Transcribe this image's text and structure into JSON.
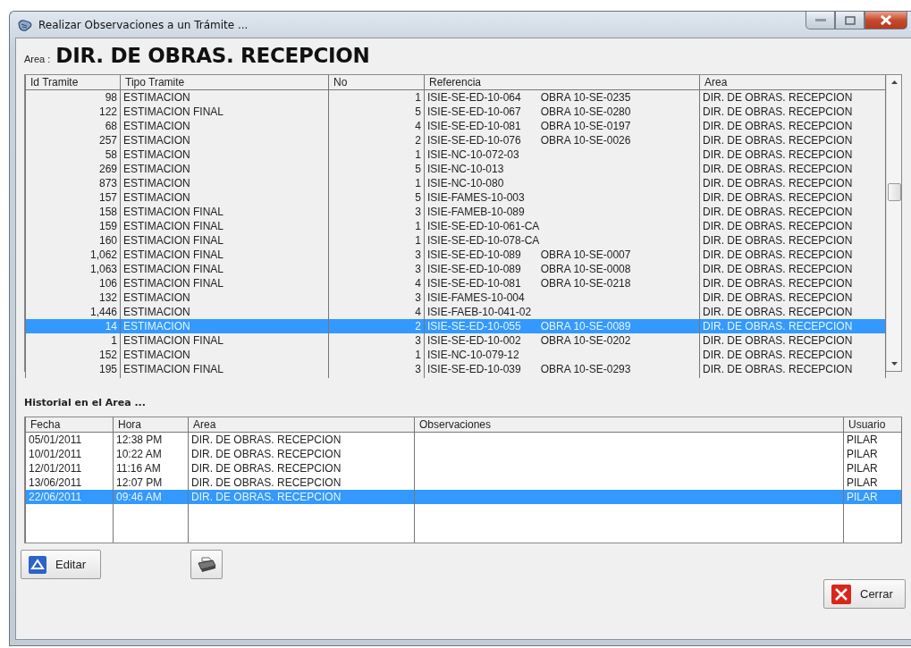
{
  "window": {
    "title": "Realizar Observaciones a un Trámite ..."
  },
  "area_header": {
    "label": "Area :",
    "value": "DIR. DE OBRAS. RECEPCION"
  },
  "tramites": {
    "columns": [
      "Id Tramite",
      "Tipo Tramite",
      "No",
      "Referencia",
      "Area"
    ],
    "rows": [
      {
        "id": "98",
        "tipo": "ESTIMACION",
        "no": "1",
        "ref": "ISIE-SE-ED-10-064",
        "obra": "OBRA 10-SE-0235",
        "area": "DIR. DE OBRAS. RECEPCION",
        "selected": false
      },
      {
        "id": "122",
        "tipo": "ESTIMACION FINAL",
        "no": "5",
        "ref": "ISIE-SE-ED-10-067",
        "obra": "OBRA 10-SE-0280",
        "area": "DIR. DE OBRAS. RECEPCION",
        "selected": false
      },
      {
        "id": "68",
        "tipo": "ESTIMACION",
        "no": "4",
        "ref": "ISIE-SE-ED-10-081",
        "obra": "OBRA 10-SE-0197",
        "area": "DIR. DE OBRAS. RECEPCION",
        "selected": false
      },
      {
        "id": "257",
        "tipo": "ESTIMACION",
        "no": "2",
        "ref": "ISIE-SE-ED-10-076",
        "obra": "OBRA 10-SE-0026",
        "area": "DIR. DE OBRAS. RECEPCION",
        "selected": false
      },
      {
        "id": "58",
        "tipo": "ESTIMACION",
        "no": "1",
        "ref": "ISIE-NC-10-072-03",
        "area": "DIR. DE OBRAS. RECEPCION",
        "selected": false
      },
      {
        "id": "269",
        "tipo": "ESTIMACION",
        "no": "5",
        "ref": "ISIE-NC-10-013",
        "area": "DIR. DE OBRAS. RECEPCION",
        "selected": false
      },
      {
        "id": "873",
        "tipo": "ESTIMACION",
        "no": "1",
        "ref": "ISIE-NC-10-080",
        "area": "DIR. DE OBRAS. RECEPCION",
        "selected": false
      },
      {
        "id": "157",
        "tipo": "ESTIMACION",
        "no": "5",
        "ref": "ISIE-FAMES-10-003",
        "area": "DIR. DE OBRAS. RECEPCION",
        "selected": false
      },
      {
        "id": "158",
        "tipo": "ESTIMACION FINAL",
        "no": "3",
        "ref": "ISIE-FAMEB-10-089",
        "area": "DIR. DE OBRAS. RECEPCION",
        "selected": false
      },
      {
        "id": "159",
        "tipo": "ESTIMACION FINAL",
        "no": "1",
        "ref": "ISIE-SE-ED-10-061-CA",
        "area": "DIR. DE OBRAS. RECEPCION",
        "selected": false
      },
      {
        "id": "160",
        "tipo": "ESTIMACION FINAL",
        "no": "1",
        "ref": "ISIE-SE-ED-10-078-CA",
        "area": "DIR. DE OBRAS. RECEPCION",
        "selected": false
      },
      {
        "id": "1,062",
        "tipo": "ESTIMACION FINAL",
        "no": "3",
        "ref": "ISIE-SE-ED-10-089",
        "obra": "OBRA 10-SE-0007",
        "area": "DIR. DE OBRAS. RECEPCION",
        "selected": false
      },
      {
        "id": "1,063",
        "tipo": "ESTIMACION FINAL",
        "no": "3",
        "ref": "ISIE-SE-ED-10-089",
        "obra": "OBRA 10-SE-0008",
        "area": "DIR. DE OBRAS. RECEPCION",
        "selected": false
      },
      {
        "id": "106",
        "tipo": "ESTIMACION FINAL",
        "no": "4",
        "ref": "ISIE-SE-ED-10-081",
        "obra": "OBRA 10-SE-0218",
        "area": "DIR. DE OBRAS. RECEPCION",
        "selected": false
      },
      {
        "id": "132",
        "tipo": "ESTIMACION",
        "no": "3",
        "ref": "ISIE-FAMES-10-004",
        "area": "DIR. DE OBRAS. RECEPCION",
        "selected": false
      },
      {
        "id": "1,446",
        "tipo": "ESTIMACION",
        "no": "4",
        "ref": "ISIE-FAEB-10-041-02",
        "area": "DIR. DE OBRAS. RECEPCION",
        "selected": false
      },
      {
        "id": "14",
        "tipo": "ESTIMACION",
        "no": "2",
        "ref": "ISIE-SE-ED-10-055",
        "obra": "OBRA 10-SE-0089",
        "area": "DIR. DE OBRAS. RECEPCION",
        "selected": true
      },
      {
        "id": "1",
        "tipo": "ESTIMACION FINAL",
        "no": "3",
        "ref": "ISIE-SE-ED-10-002",
        "obra": "OBRA 10-SE-0202",
        "area": "DIR. DE OBRAS. RECEPCION",
        "selected": false
      },
      {
        "id": "152",
        "tipo": "ESTIMACION",
        "no": "1",
        "ref": "ISIE-NC-10-079-12",
        "area": "DIR. DE OBRAS. RECEPCION",
        "selected": false
      },
      {
        "id": "195",
        "tipo": "ESTIMACION FINAL",
        "no": "3",
        "ref": "ISIE-SE-ED-10-039",
        "obra": "OBRA 10-SE-0293",
        "area": "DIR. DE OBRAS. RECEPCION",
        "selected": false
      }
    ]
  },
  "historial": {
    "title": "Historial en el Area ...",
    "columns": [
      "Fecha",
      "Hora",
      "Area",
      "Observaciones",
      "Usuario"
    ],
    "rows": [
      {
        "fecha": "05/01/2011",
        "hora": "12:38 PM",
        "area": "DIR. DE OBRAS. RECEPCION",
        "usuario": "PILAR",
        "selected": false
      },
      {
        "fecha": "10/01/2011",
        "hora": "10:22 AM",
        "area": "DIR. DE OBRAS. RECEPCION",
        "usuario": "PILAR",
        "selected": false
      },
      {
        "fecha": "12/01/2011",
        "hora": "11:16 AM",
        "area": "DIR. DE OBRAS. RECEPCION",
        "usuario": "PILAR",
        "selected": false
      },
      {
        "fecha": "13/06/2011",
        "hora": "12:07 PM",
        "area": "DIR. DE OBRAS. RECEPCION",
        "usuario": "PILAR",
        "selected": false
      },
      {
        "fecha": "22/06/2011",
        "hora": "09:46 AM",
        "area": "DIR. DE OBRAS. RECEPCION",
        "usuario": "PILAR",
        "selected": true
      }
    ]
  },
  "buttons": {
    "edit": "Editar",
    "close": "Cerrar"
  }
}
